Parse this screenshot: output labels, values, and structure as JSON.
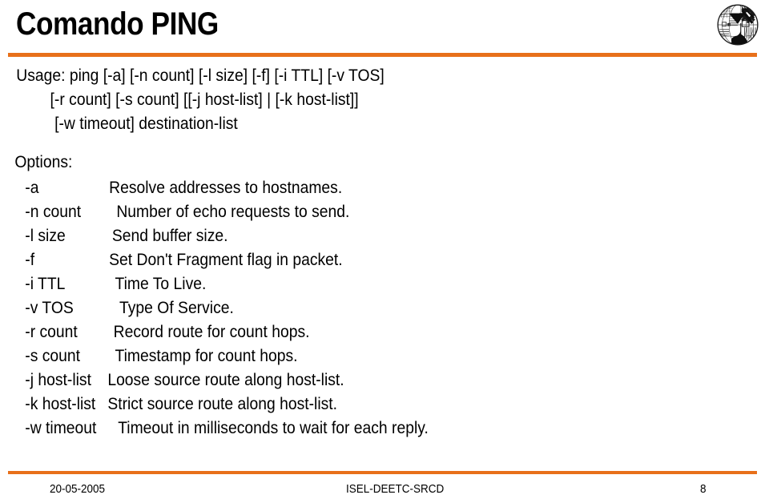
{
  "header": {
    "title": "Comando PING",
    "rule_color": "#E8701A",
    "logo_name": "isel-institution-logo"
  },
  "body": {
    "usage_lines": [
      "Usage: ping [-a] [-n count] [-l size] [-f] [-i TTL] [-v TOS]",
      "[-r count] [-s count] [[-j host-list] | [-k host-list]]",
      "[-w timeout] destination-list"
    ],
    "options_heading": "Options:",
    "options": [
      {
        "flag": "-a",
        "desc": "Resolve addresses to hostnames."
      },
      {
        "flag": "-n count",
        "desc": "Number of echo requests to send."
      },
      {
        "flag": "-l size",
        "desc": "Send buffer size."
      },
      {
        "flag": "-f",
        "desc": "Set Don't Fragment flag in packet."
      },
      {
        "flag": "-i TTL",
        "desc": "Time To Live."
      },
      {
        "flag": "-v TOS",
        "desc": "Type Of Service."
      },
      {
        "flag": "-r count",
        "desc": "Record route for count hops."
      },
      {
        "flag": "-s count",
        "desc": "Timestamp for count hops."
      },
      {
        "flag": "-j host-list",
        "desc": "Loose source route along host-list."
      },
      {
        "flag": "-k host-list",
        "desc": "Strict source route along host-list."
      },
      {
        "flag": "-w timeout",
        "desc": "Timeout in milliseconds to wait for each reply."
      }
    ]
  },
  "footer": {
    "date": "20-05-2005",
    "organization": "ISEL-DEETC-SRCD",
    "page_number": "8",
    "rule_color": "#E8701A"
  }
}
